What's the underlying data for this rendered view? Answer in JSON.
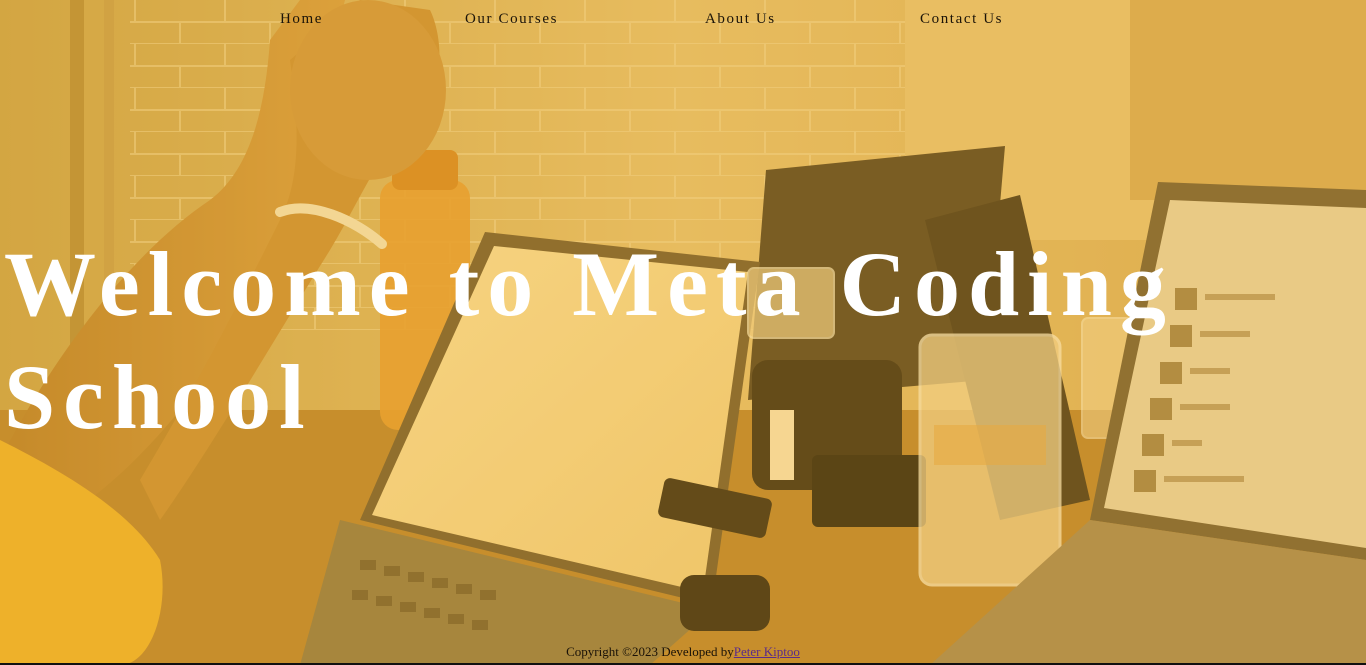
{
  "nav": {
    "items": [
      {
        "label": "Home"
      },
      {
        "label": "Our Courses"
      },
      {
        "label": "About Us"
      },
      {
        "label": "Contact Us"
      }
    ]
  },
  "hero": {
    "title": "Welcome to Meta Coding School"
  },
  "footer": {
    "copyright_text": "Copyright ©2023 Developed by",
    "developer_link": "Peter Kiptoo"
  },
  "colors": {
    "overlay_tint": "#e2b25e",
    "title_text": "#ffffff",
    "nav_text": "#1c1408",
    "link_visited": "#5a2b8a"
  }
}
